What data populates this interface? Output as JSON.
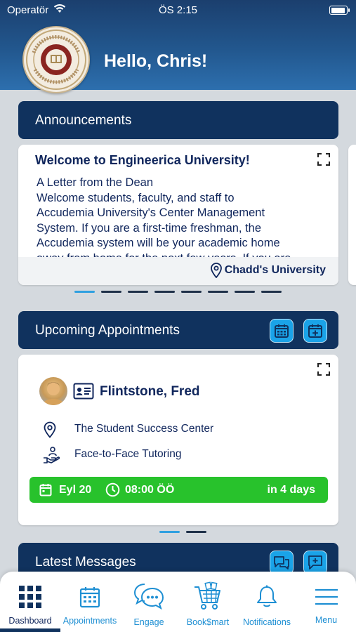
{
  "status_bar": {
    "carrier": "Operatör",
    "time": "ÖS 2:15"
  },
  "header": {
    "greeting": "Hello, Chris!"
  },
  "announcements": {
    "title": "Announcements",
    "card": {
      "title": "Welcome to Engineerica University!",
      "lines": [
        "A Letter from the Dean",
        "Welcome students, faculty, and staff to",
        "Accudemia University's Center Management",
        "System. If you are a first-time freshman, the",
        "Accudemia system will be your academic home",
        "away from home for the next few years. If you are"
      ],
      "location": "Chadd's University"
    },
    "pager_count": 8,
    "pager_active": 0
  },
  "appointments": {
    "title": "Upcoming Appointments",
    "card": {
      "name": "Flintstone, Fred",
      "center": "The Student Success Center",
      "service": "Face-to-Face Tutoring",
      "date": "Eyl 20",
      "time": "08:00 ÖÖ",
      "relative": "in 4 days"
    },
    "pager_count": 2,
    "pager_active": 0
  },
  "messages": {
    "title": "Latest Messages"
  },
  "nav": {
    "items": [
      {
        "label": "Dashboard",
        "icon": "grid-icon"
      },
      {
        "label": "Appointments",
        "icon": "calendar-icon"
      },
      {
        "label": "Engage",
        "icon": "chat-bubbles-icon"
      },
      {
        "label": "Book$mart",
        "icon": "cart-icon"
      },
      {
        "label": "Notifications",
        "icon": "bell-icon"
      },
      {
        "label": "Menu",
        "icon": "hamburger-icon"
      }
    ],
    "active": "Dashboard"
  },
  "colors": {
    "header_top": "#1b3f6e",
    "section_header": "#10325e",
    "accent_blue": "#1aa3e8",
    "appointment_green": "#28c22c",
    "nav_label": "#1e8fd3"
  }
}
